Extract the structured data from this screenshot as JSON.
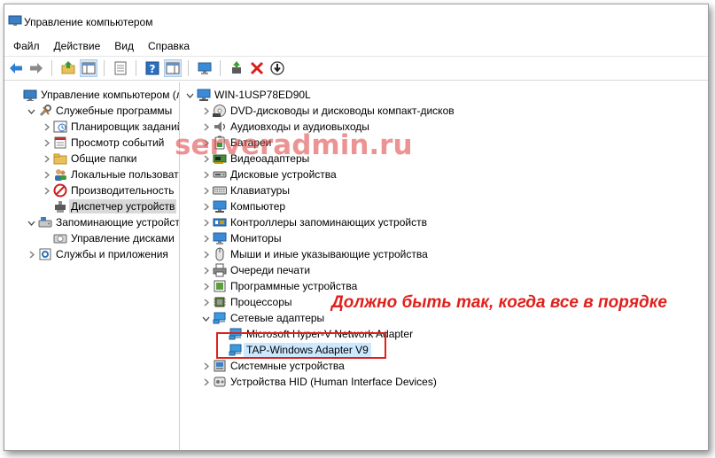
{
  "window": {
    "title": "Управление компьютером"
  },
  "menu": [
    "Файл",
    "Действие",
    "Вид",
    "Справка"
  ],
  "toolbar": {
    "buttons": [
      "back-arrow-icon",
      "forward-arrow-icon",
      "up-folder-icon",
      "show-hide-tree-icon",
      "properties-icon",
      "help-icon",
      "console-view-icon",
      "monitor-icon",
      "enable-driver-icon",
      "uninstall-x-icon",
      "update-driver-icon"
    ]
  },
  "left_tree": [
    {
      "label": "Управление компьютером (л",
      "icon": "computer-management-icon",
      "level": 0,
      "expander": "none"
    },
    {
      "label": "Служебные программы",
      "icon": "tools-icon",
      "level": 1,
      "expander": "expanded"
    },
    {
      "label": "Планировщик заданий",
      "icon": "clock-icon",
      "level": 2,
      "expander": "collapsed"
    },
    {
      "label": "Просмотр событий",
      "icon": "event-viewer-icon",
      "level": 2,
      "expander": "collapsed"
    },
    {
      "label": "Общие папки",
      "icon": "shared-folder-icon",
      "level": 2,
      "expander": "collapsed"
    },
    {
      "label": "Локальные пользовате",
      "icon": "users-icon",
      "level": 2,
      "expander": "collapsed"
    },
    {
      "label": "Производительность",
      "icon": "no-entry-icon",
      "level": 2,
      "expander": "collapsed"
    },
    {
      "label": "Диспетчер устройств",
      "icon": "device-manager-icon",
      "level": 2,
      "expander": "none",
      "selected": true
    },
    {
      "label": "Запоминающие устройст",
      "icon": "storage-icon",
      "level": 1,
      "expander": "expanded"
    },
    {
      "label": "Управление дисками",
      "icon": "disk-management-icon",
      "level": 2,
      "expander": "none"
    },
    {
      "label": "Службы и приложения",
      "icon": "services-icon",
      "level": 1,
      "expander": "collapsed"
    }
  ],
  "device_tree": [
    {
      "label": "WIN-1USP78ED90L",
      "icon": "computer-icon",
      "level": 0,
      "expander": "expanded"
    },
    {
      "label": "DVD-дисководы и дисководы компакт-дисков",
      "icon": "dvd-icon",
      "level": 1,
      "expander": "collapsed"
    },
    {
      "label": "Аудиовходы и аудиовыходы",
      "icon": "speaker-icon",
      "level": 1,
      "expander": "collapsed"
    },
    {
      "label": "Батареи",
      "icon": "battery-icon",
      "level": 1,
      "expander": "collapsed"
    },
    {
      "label": "Видеоадаптеры",
      "icon": "display-adapter-icon",
      "level": 1,
      "expander": "collapsed"
    },
    {
      "label": "Дисковые устройства",
      "icon": "disk-drive-icon",
      "level": 1,
      "expander": "collapsed"
    },
    {
      "label": "Клавиатуры",
      "icon": "keyboard-icon",
      "level": 1,
      "expander": "collapsed"
    },
    {
      "label": "Компьютер",
      "icon": "computer-icon",
      "level": 1,
      "expander": "collapsed"
    },
    {
      "label": "Контроллеры запоминающих устройств",
      "icon": "storage-controller-icon",
      "level": 1,
      "expander": "collapsed"
    },
    {
      "label": "Мониторы",
      "icon": "monitor-icon",
      "level": 1,
      "expander": "collapsed"
    },
    {
      "label": "Мыши и иные указывающие устройства",
      "icon": "mouse-icon",
      "level": 1,
      "expander": "collapsed"
    },
    {
      "label": "Очереди печати",
      "icon": "printer-icon",
      "level": 1,
      "expander": "collapsed"
    },
    {
      "label": "Программные устройства",
      "icon": "software-device-icon",
      "level": 1,
      "expander": "collapsed"
    },
    {
      "label": "Процессоры",
      "icon": "processor-icon",
      "level": 1,
      "expander": "collapsed"
    },
    {
      "label": "Сетевые адаптеры",
      "icon": "network-adapter-icon",
      "level": 1,
      "expander": "expanded"
    },
    {
      "label": "Microsoft Hyper-V Network Adapter",
      "icon": "network-adapter-icon",
      "level": 2,
      "expander": "none"
    },
    {
      "label": "TAP-Windows Adapter V9",
      "icon": "network-adapter-icon",
      "level": 2,
      "expander": "none",
      "highlighted": true
    },
    {
      "label": "Системные устройства",
      "icon": "system-device-icon",
      "level": 1,
      "expander": "collapsed"
    },
    {
      "label": "Устройства HID (Human Interface Devices)",
      "icon": "hid-icon",
      "level": 1,
      "expander": "collapsed"
    }
  ],
  "overlay": {
    "watermark": "serveradmin.ru",
    "annotation": "Должно быть так, когда все в порядке"
  },
  "colors": {
    "annotation": "#e0201c",
    "selection": "#d9d9d9",
    "highlight": "#cce8ff"
  }
}
